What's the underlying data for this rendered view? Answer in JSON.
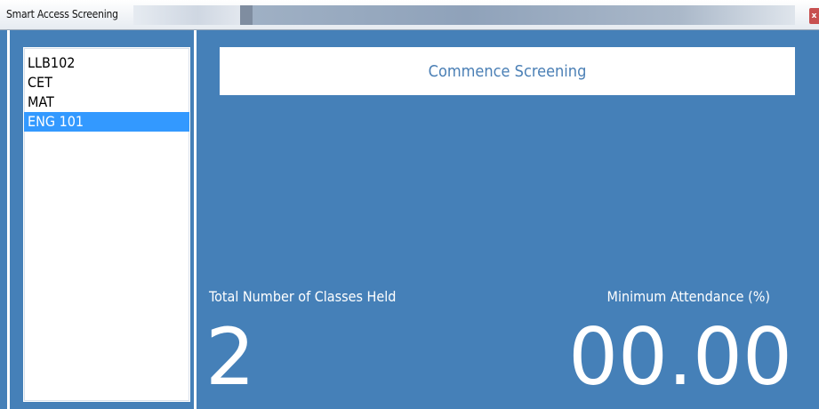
{
  "window": {
    "title": "Smart Access Screening",
    "close_label": "x"
  },
  "sidebar": {
    "items": [
      {
        "label": "LLB102",
        "selected": false
      },
      {
        "label": "CET",
        "selected": false
      },
      {
        "label": "MAT",
        "selected": false
      },
      {
        "label": "ENG 101",
        "selected": true
      }
    ]
  },
  "main": {
    "commence_label": "Commence Screening",
    "classes_label": "Total Number of Classes Held",
    "classes_value": "2",
    "attendance_label": "Minimum Attendance (%)",
    "attendance_value": "00.00"
  },
  "colors": {
    "panel_background": "#4580b8",
    "selection": "#3399ff",
    "button_text": "#4a7fb5"
  }
}
